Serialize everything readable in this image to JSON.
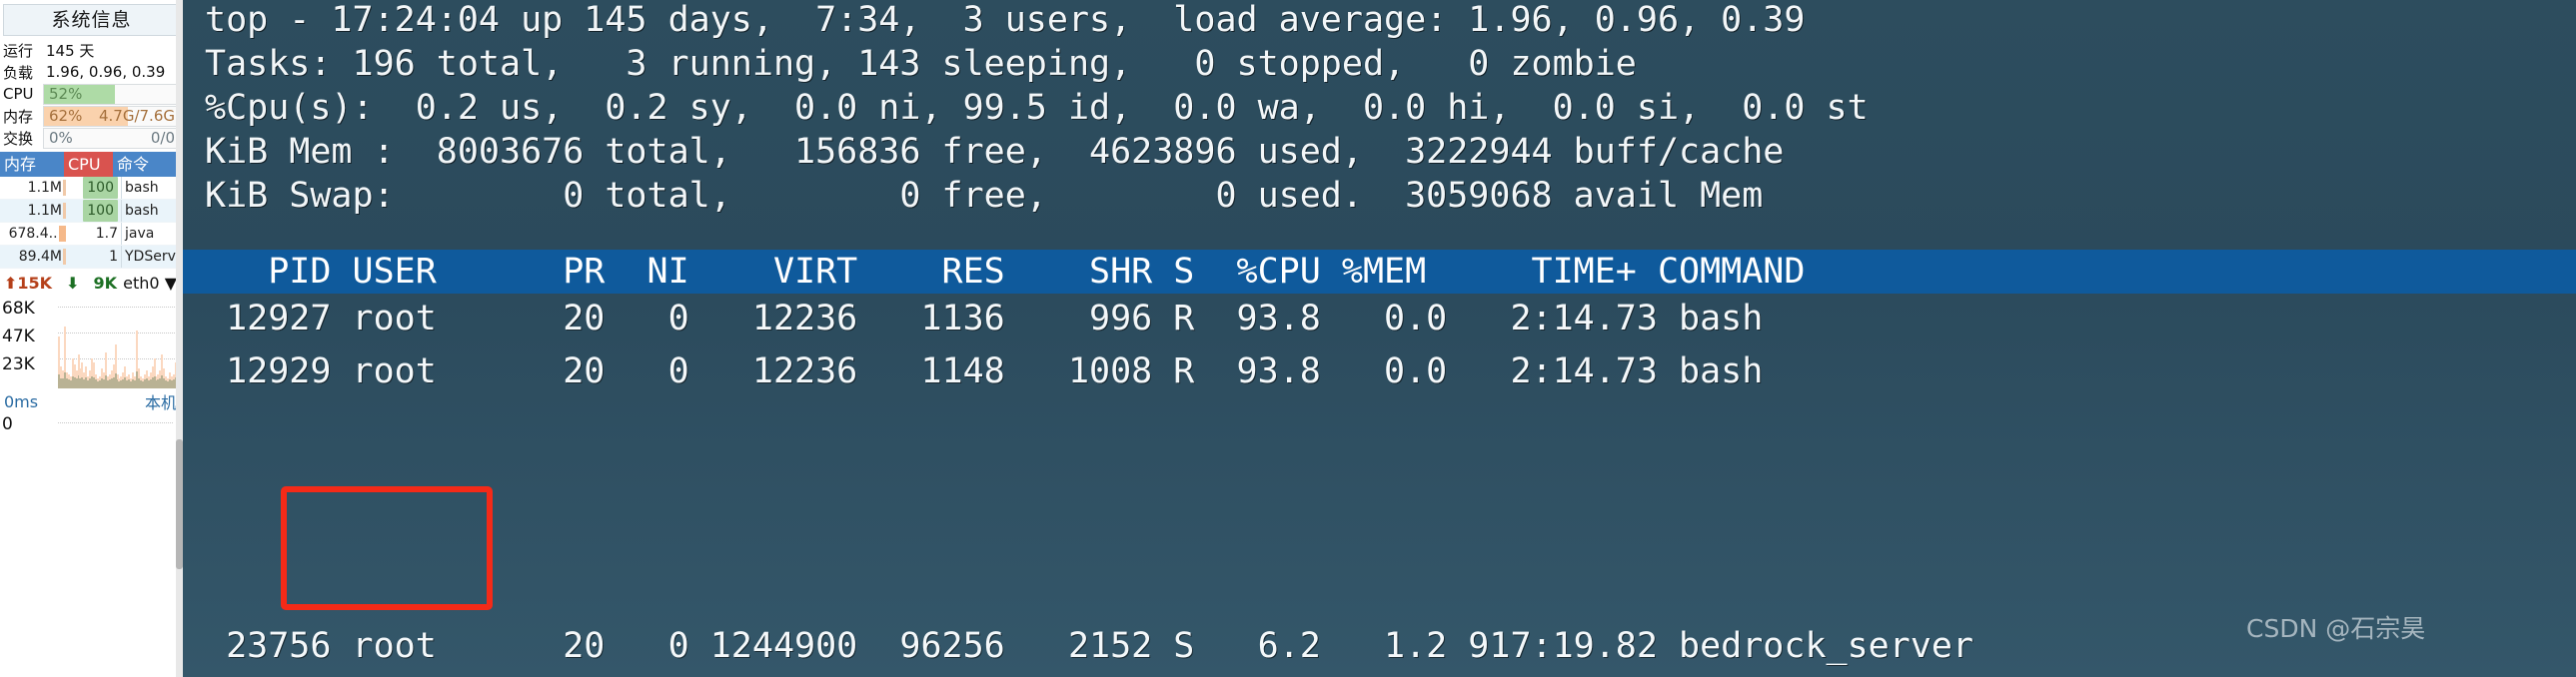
{
  "sidebar": {
    "title": "系统信息",
    "stats": [
      {
        "label": "运行",
        "text": "145 天",
        "type": "text"
      },
      {
        "label": "负载",
        "text": "1.96, 0.96, 0.39",
        "type": "text"
      },
      {
        "label": "CPU",
        "type": "bar",
        "percent": 52,
        "left": "52%",
        "right": "",
        "fill": "#aedba6"
      },
      {
        "label": "内存",
        "type": "bar",
        "percent": 62,
        "left": "62%",
        "right": "4.7G/7.6G",
        "fill": "#fad2ad"
      },
      {
        "label": "交换",
        "type": "bar",
        "percent": 0,
        "left": "0%",
        "right": "0/0",
        "fill": "#dfe6ea"
      }
    ],
    "proc_table": {
      "headers": {
        "mem": "内存",
        "cpu": "CPU",
        "cmd": "命令"
      },
      "rows": [
        {
          "mem": "1.1M",
          "cpu": "100",
          "cmd": "bash",
          "cpu_hl": true
        },
        {
          "mem": "1.1M",
          "cpu": "100",
          "cmd": "bash",
          "cpu_hl": true
        },
        {
          "mem": "678.4...",
          "cpu": "1.7",
          "cmd": "java",
          "cpu_hl": false
        },
        {
          "mem": "89.4M",
          "cpu": "1",
          "cmd": "YDService",
          "cpu_hl": false
        }
      ]
    },
    "network": {
      "upload": "15K",
      "download": "9K",
      "interface": "eth0",
      "up_arrow_icon": "arrow-up-icon",
      "down_arrow_icon": "arrow-down-icon",
      "dropdown_icon": "chevron-down-icon",
      "y_labels": [
        "68K",
        "47K",
        "23K"
      ]
    },
    "latency": {
      "value": "0ms",
      "host": "本机",
      "y_labels": [
        "0"
      ]
    }
  },
  "terminal": {
    "lines": [
      "top - 17:24:04 up 145 days,  7:34,  3 users,  load average: 1.96, 0.96, 0.39",
      "Tasks: 196 total,   3 running, 143 sleeping,   0 stopped,   0 zombie",
      "%Cpu(s):  0.2 us,  0.2 sy,  0.0 ni, 99.5 id,  0.0 wa,  0.0 hi,  0.0 si,  0.0 st",
      "KiB Mem :  8003676 total,   156836 free,  4623896 used,  3222944 buff/cache",
      "KiB Swap:        0 total,        0 free,        0 used.  3059068 avail Mem"
    ],
    "table_header": "   PID USER      PR  NI    VIRT    RES    SHR S  %CPU %MEM     TIME+ COMMAND",
    "rows": [
      " 12927 root      20   0   12236   1136    996 R  93.8   0.0   2:14.73 bash",
      " 12929 root      20   0   12236   1148   1008 R  93.8   0.0   2:14.73 bash",
      " 23756 root      20   0 1244900  96256   2152 S   6.2   1.2 917:19.82 bedrock_server"
    ],
    "header_bg": "#0f5a9c",
    "background": "#2d4d5e"
  },
  "annotation": {
    "color": "#f42a18",
    "label": "pid-highlight-box"
  },
  "watermark": {
    "text": "CSDN @石宗昊"
  }
}
